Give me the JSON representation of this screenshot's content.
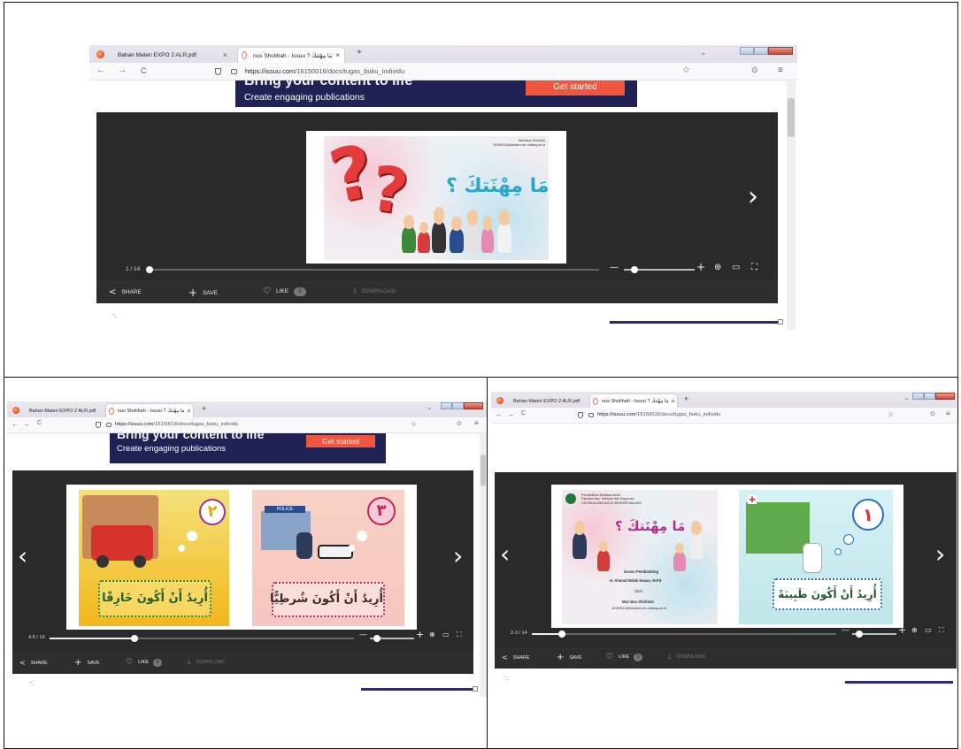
{
  "browser": {
    "tab1_title": "Bahan Materi EXPO 2 ALR.pdf",
    "tab2_title": "nus Sholihah - Issuu ? مَا مِهْنَتكَ",
    "tab_close": "×",
    "new_tab": "+",
    "url_host": "https://issuu.com",
    "url_path": "/16150016/docs/tugas_buku_individu",
    "back": "←",
    "forward": "→",
    "reload": "C",
    "star": "☆",
    "pocket": "⊙",
    "menu": "≡",
    "chevron": "⌄"
  },
  "banner": {
    "headline": "Bring your content to life",
    "subline": "Create engaging publications",
    "cta": "Get started"
  },
  "viewer_top": {
    "page_counter": "1 / 14",
    "cover_title": "مَا مِهْنَتكَ ؟",
    "cover_author_line1": "Mar'atus Sholihah",
    "cover_author_line2": "16150016@student.uin-malang.ac.id",
    "progress_fraction": 0.0
  },
  "viewer_bl": {
    "page_counter": "4-5 / 14",
    "page4_number": "٢",
    "page4_text": "أُرِيدُ أَنْ أَكُونَ خَارِقًا",
    "page5_number": "٣",
    "page5_text": "أُرِيدُ أَنْ أَكُونَ شُرطِيًّا",
    "police_sign": "POLICE",
    "progress_fraction": 0.28
  },
  "viewer_br": {
    "page_counter": "2-3 / 14",
    "page2_inst1": "Pendidikan Bahasa Arab",
    "page2_inst2": "Fakultas Ilmu Tarbiyah dan Keguruan",
    "page2_inst3": "UIN MAULANA MALIK IBRAHIM MALANG",
    "page2_title": "مَا مِهْنَتكَ ؟",
    "page2_dosen": "Dosen Pembimbing",
    "page2_dosen_name": "H. Ahmad Makki Hasan, M.Pd",
    "page2_oleh": "Oleh :",
    "page2_author": "Mar'atus Sholihah",
    "page2_email": "16150016@student.uin-malang.ac.id",
    "page3_number": "١",
    "page3_text": "أُرِيدُ أَنْ أَكُونَ طَبِيبَةً",
    "progress_fraction": 0.1
  },
  "controls": {
    "minus": "—",
    "plus": "+",
    "search_zoom": "⊕",
    "single_page": "▭",
    "fullscreen": "⛶",
    "arrow_left": "‹",
    "arrow_right": "›"
  },
  "actions": {
    "share": "SHARE",
    "save": "SAVE",
    "like": "LIKE",
    "like_count": "0",
    "download": "DOWNLOAD",
    "share_icon": "share-icon",
    "save_icon": "plus-icon",
    "like_icon": "heart-icon",
    "download_icon": "download-icon"
  },
  "colors": {
    "banner_bg": "#1f2252",
    "cta_bg": "#f0553d",
    "viewer_bg": "#2a2a2a",
    "tab_accent": "#f36d5a"
  }
}
